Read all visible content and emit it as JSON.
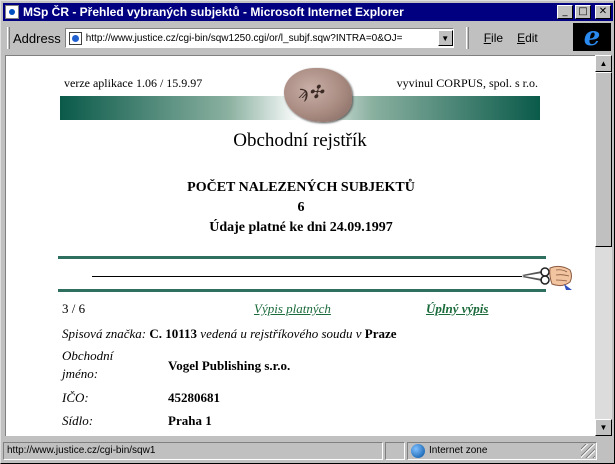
{
  "window": {
    "title": "MSp ČR - Přehled vybraných subjektů - Microsoft Internet Explorer",
    "minimize_glyph": "_",
    "maximize_glyph": "□",
    "close_glyph": "✕"
  },
  "addressbar": {
    "label": "Address",
    "url": "http://www.justice.cz/cgi-bin/sqw1250.cgi/or/l_subjf.sqw?INTRA=0&OJ=",
    "dropdown_glyph": "▼"
  },
  "menu": {
    "file_first": "F",
    "file_rest": "ile",
    "edit_first": "E",
    "edit_rest": "dit"
  },
  "brand": {
    "logo_letter": "e"
  },
  "banner": {
    "version": "verze aplikace 1.06 / 15.9.97",
    "developer": "vyvinul CORPUS, spol. s r.o.",
    "registry_name": "Obchodní rejstřík"
  },
  "results": {
    "heading": "POČET NALEZENÝCH SUBJEKTŮ",
    "count": "6",
    "valid_date": "Údaje platné ke dni 24.09.1997"
  },
  "navigation": {
    "position": "3 / 6",
    "link_valid": "Výpis platných",
    "link_full": "Úplný výpis"
  },
  "record": {
    "file_label": "Spisová značka:",
    "file_value": "C. 10113",
    "file_mid": "vedená u rejstříkového soudu v",
    "court": "Praze",
    "name_label_1": "Obchodní",
    "name_label_2": "jméno:",
    "name_value": "Vogel Publishing s.r.o.",
    "ico_label": "IČO:",
    "ico_value": "45280681",
    "seat_label": "Sídlo:",
    "seat_value": "Praha 1"
  },
  "statusbar": {
    "url": "http://www.justice.cz/cgi-bin/sqw1",
    "zone": "Internet zone"
  },
  "colors": {
    "titlebar": "#000080",
    "accent_green": "#2f6f5f",
    "link": "#1a6a3a"
  },
  "icons": {
    "page": "page-icon",
    "zone": "globe-icon",
    "scissors": "scissors-hand-icon"
  }
}
